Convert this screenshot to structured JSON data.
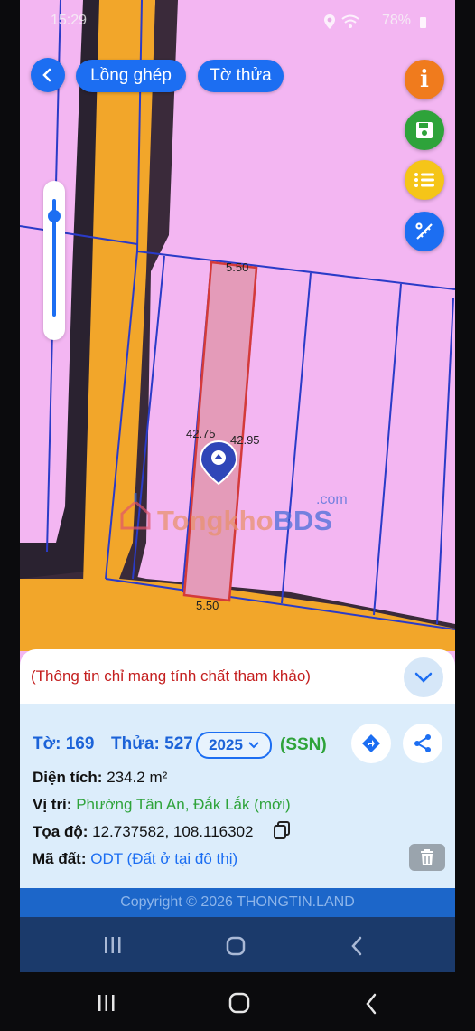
{
  "status_bar": {
    "time": "15:29",
    "battery": "78%"
  },
  "toolbar": {
    "back_icon": "chevron-left-icon",
    "layer_label": "Lồng ghép",
    "parcel_label": "Tờ thửa"
  },
  "side_buttons": [
    {
      "name": "info-icon",
      "color": "#f07b1d"
    },
    {
      "name": "save-icon",
      "color": "#2ea33a"
    },
    {
      "name": "list-icon",
      "color": "#f5c518"
    },
    {
      "name": "measure-icon",
      "color": "#1c6ef2"
    }
  ],
  "zoom": {
    "level": 0.9
  },
  "map": {
    "dimensions": {
      "top": "5.50",
      "bottom": "5.50",
      "left": "42.75",
      "right": "42.95"
    },
    "watermark": {
      "brand_a": "Tongkho",
      "brand_b": "BDS",
      "suffix": ".com"
    }
  },
  "panel": {
    "notice": "(Thông tin chỉ mang tính chất tham khảo)",
    "sheet_label": "Tờ: 169",
    "parcel_label": "Thửa: 527",
    "year": "2025",
    "ssn": "(SSN)",
    "area_label": "Diện tích:",
    "area_value": "234.2 m²",
    "location_label": "Vị trí:",
    "location_value": "Phường Tân An, Đắk Lắk (mới)",
    "coord_label": "Tọa độ:",
    "coord_value": "12.737582, 108.116302",
    "landcode_label": "Mã đất:",
    "landcode_value": "ODT (Đất ở tại đô thị)"
  },
  "footer": {
    "copyright": "Copyright © 2026 THONGTIN.LAND"
  }
}
